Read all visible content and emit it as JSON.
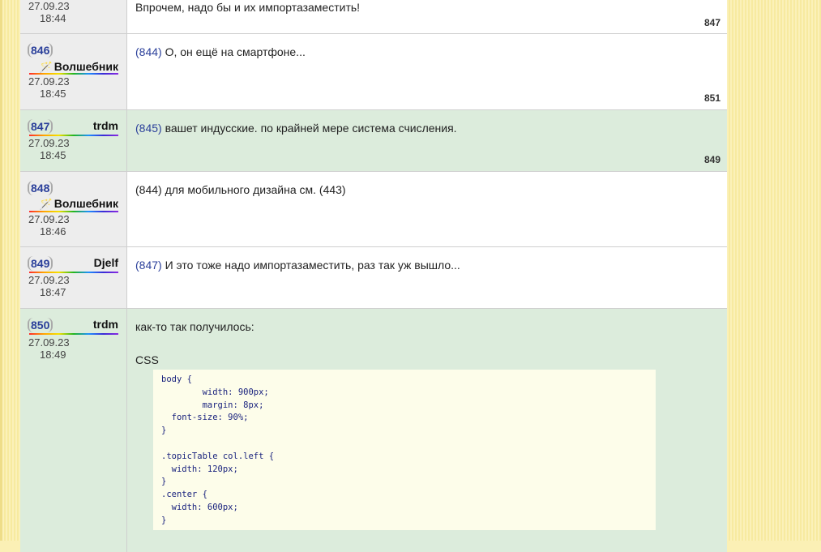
{
  "posts": [
    {
      "date": "27.09.23",
      "time": "18:44",
      "text": "Впрочем, надо бы и их импортазаместить!",
      "ref": "847"
    },
    {
      "number": "846",
      "author": "Волшебник",
      "date": "27.09.23",
      "time": "18:45",
      "reply_to": "844",
      "text": " О, он ещё на смартфоне...",
      "ref": "851"
    },
    {
      "number": "847",
      "author": "trdm",
      "date": "27.09.23",
      "time": "18:45",
      "reply_to": "845",
      "text": " вашет индусские. по крайней мере система счисления.",
      "ref": "849"
    },
    {
      "number": "848",
      "author": "Волшебник",
      "date": "27.09.23",
      "time": "18:46",
      "text": "(844) для мобильного дизайна см. (443)"
    },
    {
      "number": "849",
      "author": "Djelf",
      "date": "27.09.23",
      "time": "18:47",
      "reply_to": "847",
      "text": " И это тоже надо импортазаместить, раз так уж вышло..."
    },
    {
      "number": "850",
      "author": "trdm",
      "date": "27.09.23",
      "time": "18:49",
      "text": "как-то так получилось:",
      "code_label": "CSS",
      "code": "body {\n        width: 900px;\n        margin: 8px;\n  font-size: 90%;\n}\n\n.topicTable col.left {\n  width: 120px;\n}\n.center {\n  width: 600px;\n}"
    }
  ],
  "icons": {
    "wand": "wand-icon"
  },
  "colors": {
    "post_number": "#2a3f9a",
    "alt_row": "#dcecdc",
    "page_background": "#fbf0b5",
    "code_background": "#fdfdea"
  }
}
